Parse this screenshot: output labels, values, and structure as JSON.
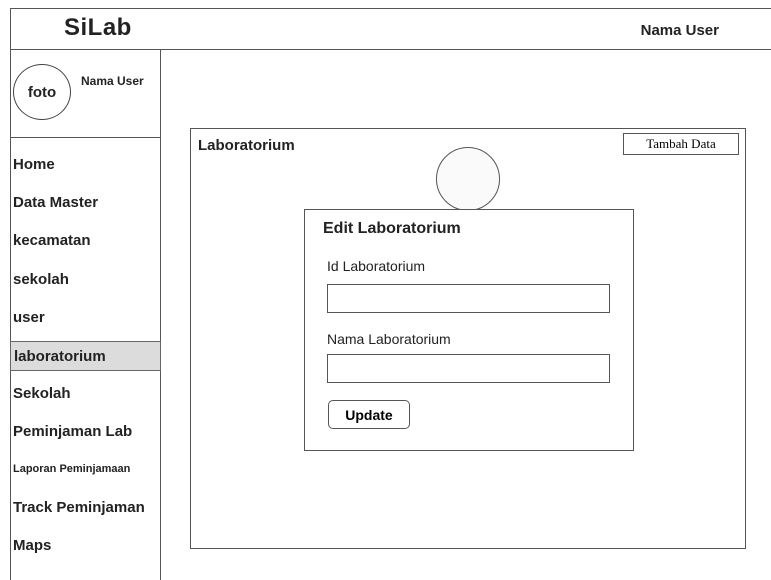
{
  "header": {
    "brand": "SiLab",
    "user": "Nama User"
  },
  "profile": {
    "avatar_label": "foto",
    "name": "Nama User"
  },
  "sidebar": {
    "items": [
      {
        "label": "Home"
      },
      {
        "label": "Data Master"
      },
      {
        "label": "kecamatan"
      },
      {
        "label": "sekolah"
      },
      {
        "label": "user"
      },
      {
        "label": "laboratorium",
        "active": true
      },
      {
        "label": "Sekolah"
      },
      {
        "label": "Peminjaman Lab"
      },
      {
        "label": "Laporan Peminjamaan"
      },
      {
        "label": "Track Peminjaman"
      },
      {
        "label": "Maps"
      }
    ]
  },
  "panel": {
    "title": "Laboratorium",
    "add_label": "Tambah Data"
  },
  "modal": {
    "title": "Edit  Laboratorium",
    "fields": [
      {
        "label": "Id Laboratorium",
        "value": ""
      },
      {
        "label": "Nama Laboratorium",
        "value": ""
      }
    ],
    "submit_label": "Update"
  }
}
